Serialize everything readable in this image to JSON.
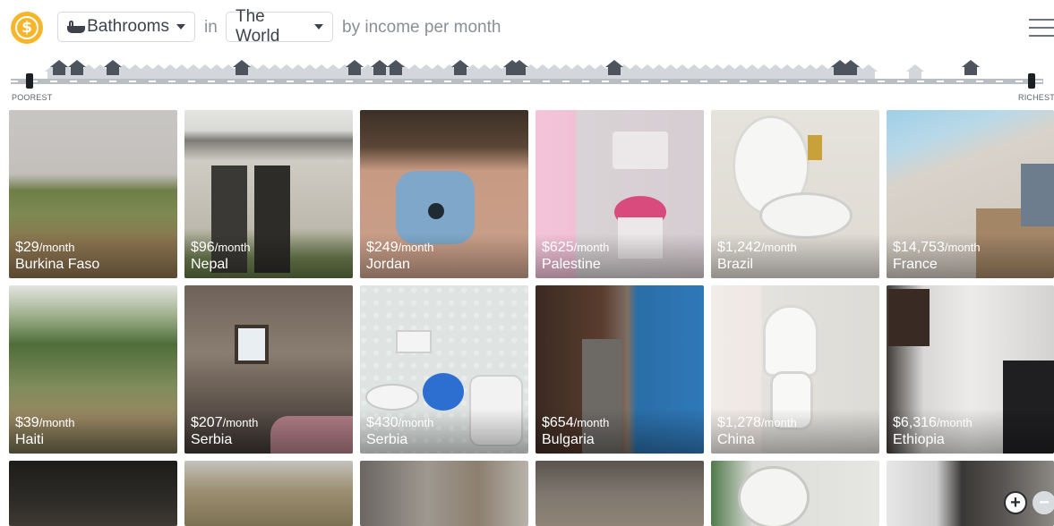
{
  "header": {
    "category": "Bathrooms",
    "in_text": "in",
    "region": "The World",
    "sort_text": "by income per month",
    "logo_symbol": "$"
  },
  "strip": {
    "poorest_label": "POOREST",
    "richest_label": "RICHEST"
  },
  "colors": {
    "logo": "#f7b52b",
    "house": "#4e545e",
    "track": "#b9bec5"
  },
  "tiles_row1": [
    {
      "price": "$29",
      "per": "/month",
      "place": "Burkina Faso"
    },
    {
      "price": "$96",
      "per": "/month",
      "place": "Nepal"
    },
    {
      "price": "$249",
      "per": "/month",
      "place": "Jordan"
    },
    {
      "price": "$625",
      "per": "/month",
      "place": "Palestine"
    },
    {
      "price": "$1,242",
      "per": "/month",
      "place": "Brazil"
    },
    {
      "price": "$14,753",
      "per": "/month",
      "place": "France"
    }
  ],
  "tiles_row2": [
    {
      "price": "$39",
      "per": "/month",
      "place": "Haiti"
    },
    {
      "price": "$207",
      "per": "/month",
      "place": "Serbia"
    },
    {
      "price": "$430",
      "per": "/month",
      "place": "Serbia"
    },
    {
      "price": "$654",
      "per": "/month",
      "place": "Bulgaria"
    },
    {
      "price": "$1,278",
      "per": "/month",
      "place": "China"
    },
    {
      "price": "$6,316",
      "per": "/month",
      "place": "Ethiopia"
    }
  ],
  "zoom": {
    "in_symbol": "+",
    "out_symbol": "−"
  }
}
